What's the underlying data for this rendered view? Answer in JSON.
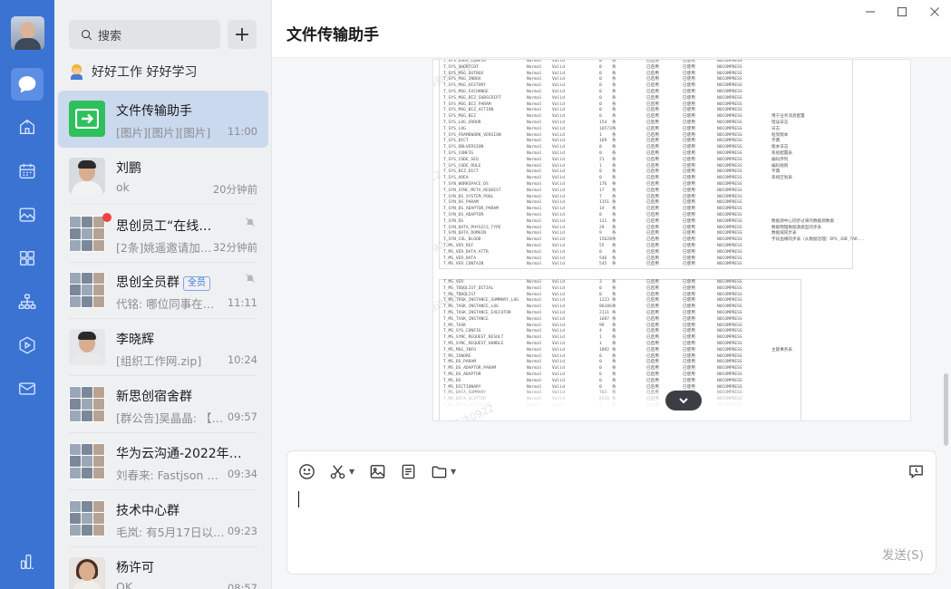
{
  "window": {
    "title": "文件传输助手",
    "controls": [
      "minimize",
      "maximize",
      "close"
    ]
  },
  "rail": {
    "items": [
      "chat-icon",
      "contacts-icon",
      "calendar-icon",
      "docs-icon",
      "apps-icon",
      "org-icon",
      "meeting-icon",
      "mail-icon",
      "more-icon"
    ],
    "active": "chat-icon",
    "accent": "#3b73d3"
  },
  "list": {
    "search_placeholder": "搜索",
    "status": "好好工作 好好学习",
    "conversations": [
      {
        "name": "文件传输助手",
        "preview": "[图片][图片][图片]",
        "time": "11:00",
        "selected": true
      },
      {
        "name": "刘鹏",
        "preview": "ok",
        "time": "20分钟前"
      },
      {
        "name": "思创员工“在线文…",
        "preview": "[2条]姚遥邀请加…",
        "time": "32分钟前",
        "muted": true,
        "unread": true
      },
      {
        "name": "思创全员群",
        "tag": "全员",
        "preview": "代铭: 哪位同事在二…",
        "time": "11:11",
        "muted": true
      },
      {
        "name": "李晓辉",
        "preview": "[组织工作网.zip]",
        "time": "10:24"
      },
      {
        "name": "新思创宿舍群",
        "preview": "[群公告]吴晶晶: 【…",
        "time": "09:57"
      },
      {
        "name": "华为云沟通-2022年…",
        "preview": "刘春来: Fastjson <…",
        "time": "09:34"
      },
      {
        "name": "技术中心群",
        "preview": "毛岚: 有5月17日以…",
        "time": "09:23"
      },
      {
        "name": "杨许可",
        "preview": "OK",
        "time": "08:57"
      }
    ]
  },
  "composer": {
    "tools": [
      "emoji-icon",
      "screenshot-icon",
      "image-icon",
      "document-icon",
      "folder-icon",
      "history-icon"
    ],
    "send_label": "发送(S)"
  },
  "image_message": {
    "watermark": "蒋丽达0922",
    "sheet1_rows": [
      [
        "T_SYS_USER_CONFIG",
        "0",
        "NOCOMPRESS",
        ""
      ],
      [
        "T_SYS_SHORTCUT",
        "0",
        "NOCOMPRESS",
        ""
      ],
      [
        "T_SYS_MSG_OUTBOX",
        "0",
        "NOCOMPRESS",
        ""
      ],
      [
        "T_SYS_MSG_INBOX",
        "0",
        "NOCOMPRESS",
        ""
      ],
      [
        "T_SYS_MSG_HISTORY",
        "0",
        "NOCOMPRESS",
        ""
      ],
      [
        "T_SYS_MSG_EXCHANGE",
        "0",
        "NOCOMPRESS",
        ""
      ],
      [
        "T_SYS_MSG_BIZ_SUBSCRIPT",
        "0",
        "NOCOMPRESS",
        ""
      ],
      [
        "T_SYS_MSG_BIZ_PARAM",
        "0",
        "NOCOMPRESS",
        ""
      ],
      [
        "T_SYS_MSG_BIZ_ACTION",
        "0",
        "NOCOMPRESS",
        ""
      ],
      [
        "T_SYS_MSG_BIZ",
        "0",
        "NOCOMPRESS",
        "用于业务消息配置"
      ],
      [
        "T_SYS_LOG_ERROR",
        "154",
        "NOCOMPRESS",
        "错误日志"
      ],
      [
        "T_SYS_LOG",
        "16573",
        "NOCOMPRESS",
        "日志"
      ],
      [
        "T_SYS_FRAMEWORK_VERSION",
        "1",
        "NOCOMPRESS",
        "框架版本"
      ],
      [
        "T_SYS_DICT",
        "169",
        "NOCOMPRESS",
        "字典"
      ],
      [
        "T_SYS_DBLVERSION",
        "0",
        "NOCOMPRESS",
        "版本日志"
      ],
      [
        "T_SYS_CONFIG",
        "0",
        "NOCOMPRESS",
        "系统配置表"
      ],
      [
        "T_SYS_CODE_SEQ",
        "21",
        "NOCOMPRESS",
        "编码序列"
      ],
      [
        "T_SYS_CODE_RULE",
        "1",
        "NOCOMPRESS",
        "编码规则"
      ],
      [
        "T_SYS_BIZ_DICT",
        "0",
        "NOCOMPRESS",
        "字典"
      ],
      [
        "T_SYS_AREA",
        "0",
        "NOCOMPRESS",
        "系统区划表"
      ],
      [
        "T_SYN_WORKSPACE_DS",
        "176",
        "NOCOMPRESS",
        ""
      ],
      [
        "T_SYN_SYNC_META_REQUEST",
        "17",
        "NOCOMPRESS",
        ""
      ],
      [
        "T_SYN_DS_SYSTEM_POOL",
        "7",
        "NOCOMPRESS",
        ""
      ],
      [
        "T_SYN_DS_PARAM",
        "1151",
        "NOCOMPRESS",
        ""
      ],
      [
        "T_SYN_DS_ADAPTOR_PARAM",
        "14",
        "NOCOMPRESS",
        ""
      ],
      [
        "T_SYN_DS_ADAPTOR",
        "8",
        "NOCOMPRESS",
        ""
      ],
      [
        "T_SYN_DS",
        "131",
        "NOCOMPRESS",
        "数据源中心同步过来的数据源数据"
      ],
      [
        "T_SYN_DATA_PHYSICS_TYPE",
        "29",
        "NOCOMPRESS",
        "数据物理数据源类型同步表"
      ],
      [
        "T_SYN_DATA_DOMAIN",
        "9",
        "NOCOMPRESS",
        "数据域同步表"
      ],
      [
        "T_SYN_COL_BLOOD",
        "15628",
        "NOCOMPRESS",
        "字段血缘同步表（从数据治理）DPS_JOB_TAR..."
      ],
      [
        "T_MS_VER_REF",
        "55",
        "NOCOMPRESS",
        ""
      ],
      [
        "T_MS_VER_DATA_ATTR",
        "0",
        "NOCOMPRESS",
        ""
      ],
      [
        "T_MS_VER_DATA",
        "546",
        "NOCOMPRESS",
        ""
      ],
      [
        "T_MS_VER_CONTAIN",
        "545",
        "NOCOMPRESS",
        ""
      ]
    ],
    "sheet2_rows": [
      [
        "T_MS_VER",
        "3",
        "NOCOMPRESS",
        ""
      ],
      [
        "T_MS_TODOLIST_DITIAL",
        "0",
        "NOCOMPRESS",
        ""
      ],
      [
        "T_MS_TODOLIST",
        "0",
        "NOCOMPRESS",
        ""
      ],
      [
        "T_MS_TASK_INSTANCE_SUMMARY_LOG",
        "1223",
        "NOCOMPRESS",
        ""
      ],
      [
        "T_MS_TASK_INSTANCE_LOG",
        "86186",
        "NOCOMPRESS",
        ""
      ],
      [
        "T_MS_TASK_INSTANCE_EXECUTOR",
        "2111",
        "NOCOMPRESS",
        ""
      ],
      [
        "T_MS_TASK_INSTANCE",
        "1687",
        "NOCOMPRESS",
        ""
      ],
      [
        "T_MS_TASK",
        "99",
        "NOCOMPRESS",
        ""
      ],
      [
        "T_MS_SYS_CONFIG",
        "4",
        "NOCOMPRESS",
        ""
      ],
      [
        "T_MS_SYNC_REQUEST_RESULT",
        "1",
        "NOCOMPRESS",
        ""
      ],
      [
        "T_MS_SYNC_REQUEST_HANDLE",
        "1",
        "NOCOMPRESS",
        ""
      ],
      [
        "T_MS_MSG_INFO",
        "1892",
        "NOCOMPRESS",
        "主题事务表"
      ],
      [
        "T_MS_IGNORE",
        "0",
        "NOCOMPRESS",
        ""
      ],
      [
        "T_MS_DS_PARAM",
        "0",
        "NOCOMPRESS",
        ""
      ],
      [
        "T_MS_DS_ADAPTOR_PARAM",
        "0",
        "NOCOMPRESS",
        ""
      ],
      [
        "T_MS_DS_ADAPTOR",
        "0",
        "NOCOMPRESS",
        ""
      ],
      [
        "T_MS_DS",
        "0",
        "NOCOMPRESS",
        ""
      ],
      [
        "T_MS_DICTIONARY",
        "0",
        "NOCOMPRESS",
        ""
      ],
      [
        "T_MS_DATA_SUMMARY",
        "763",
        "NOCOMPRESS",
        ""
      ],
      [
        "T_MS_DATA_SCATTER",
        "8316",
        "NOCOMPRESS",
        ""
      ],
      [
        "T_MS_DATA_RELATIONS",
        "0",
        "NOCOMPRESS",
        ""
      ]
    ],
    "col_normal": "Normal",
    "col_valid": "Valid",
    "col_unit": "条",
    "col_enabled": "已启用",
    "col_used": "已使用"
  }
}
